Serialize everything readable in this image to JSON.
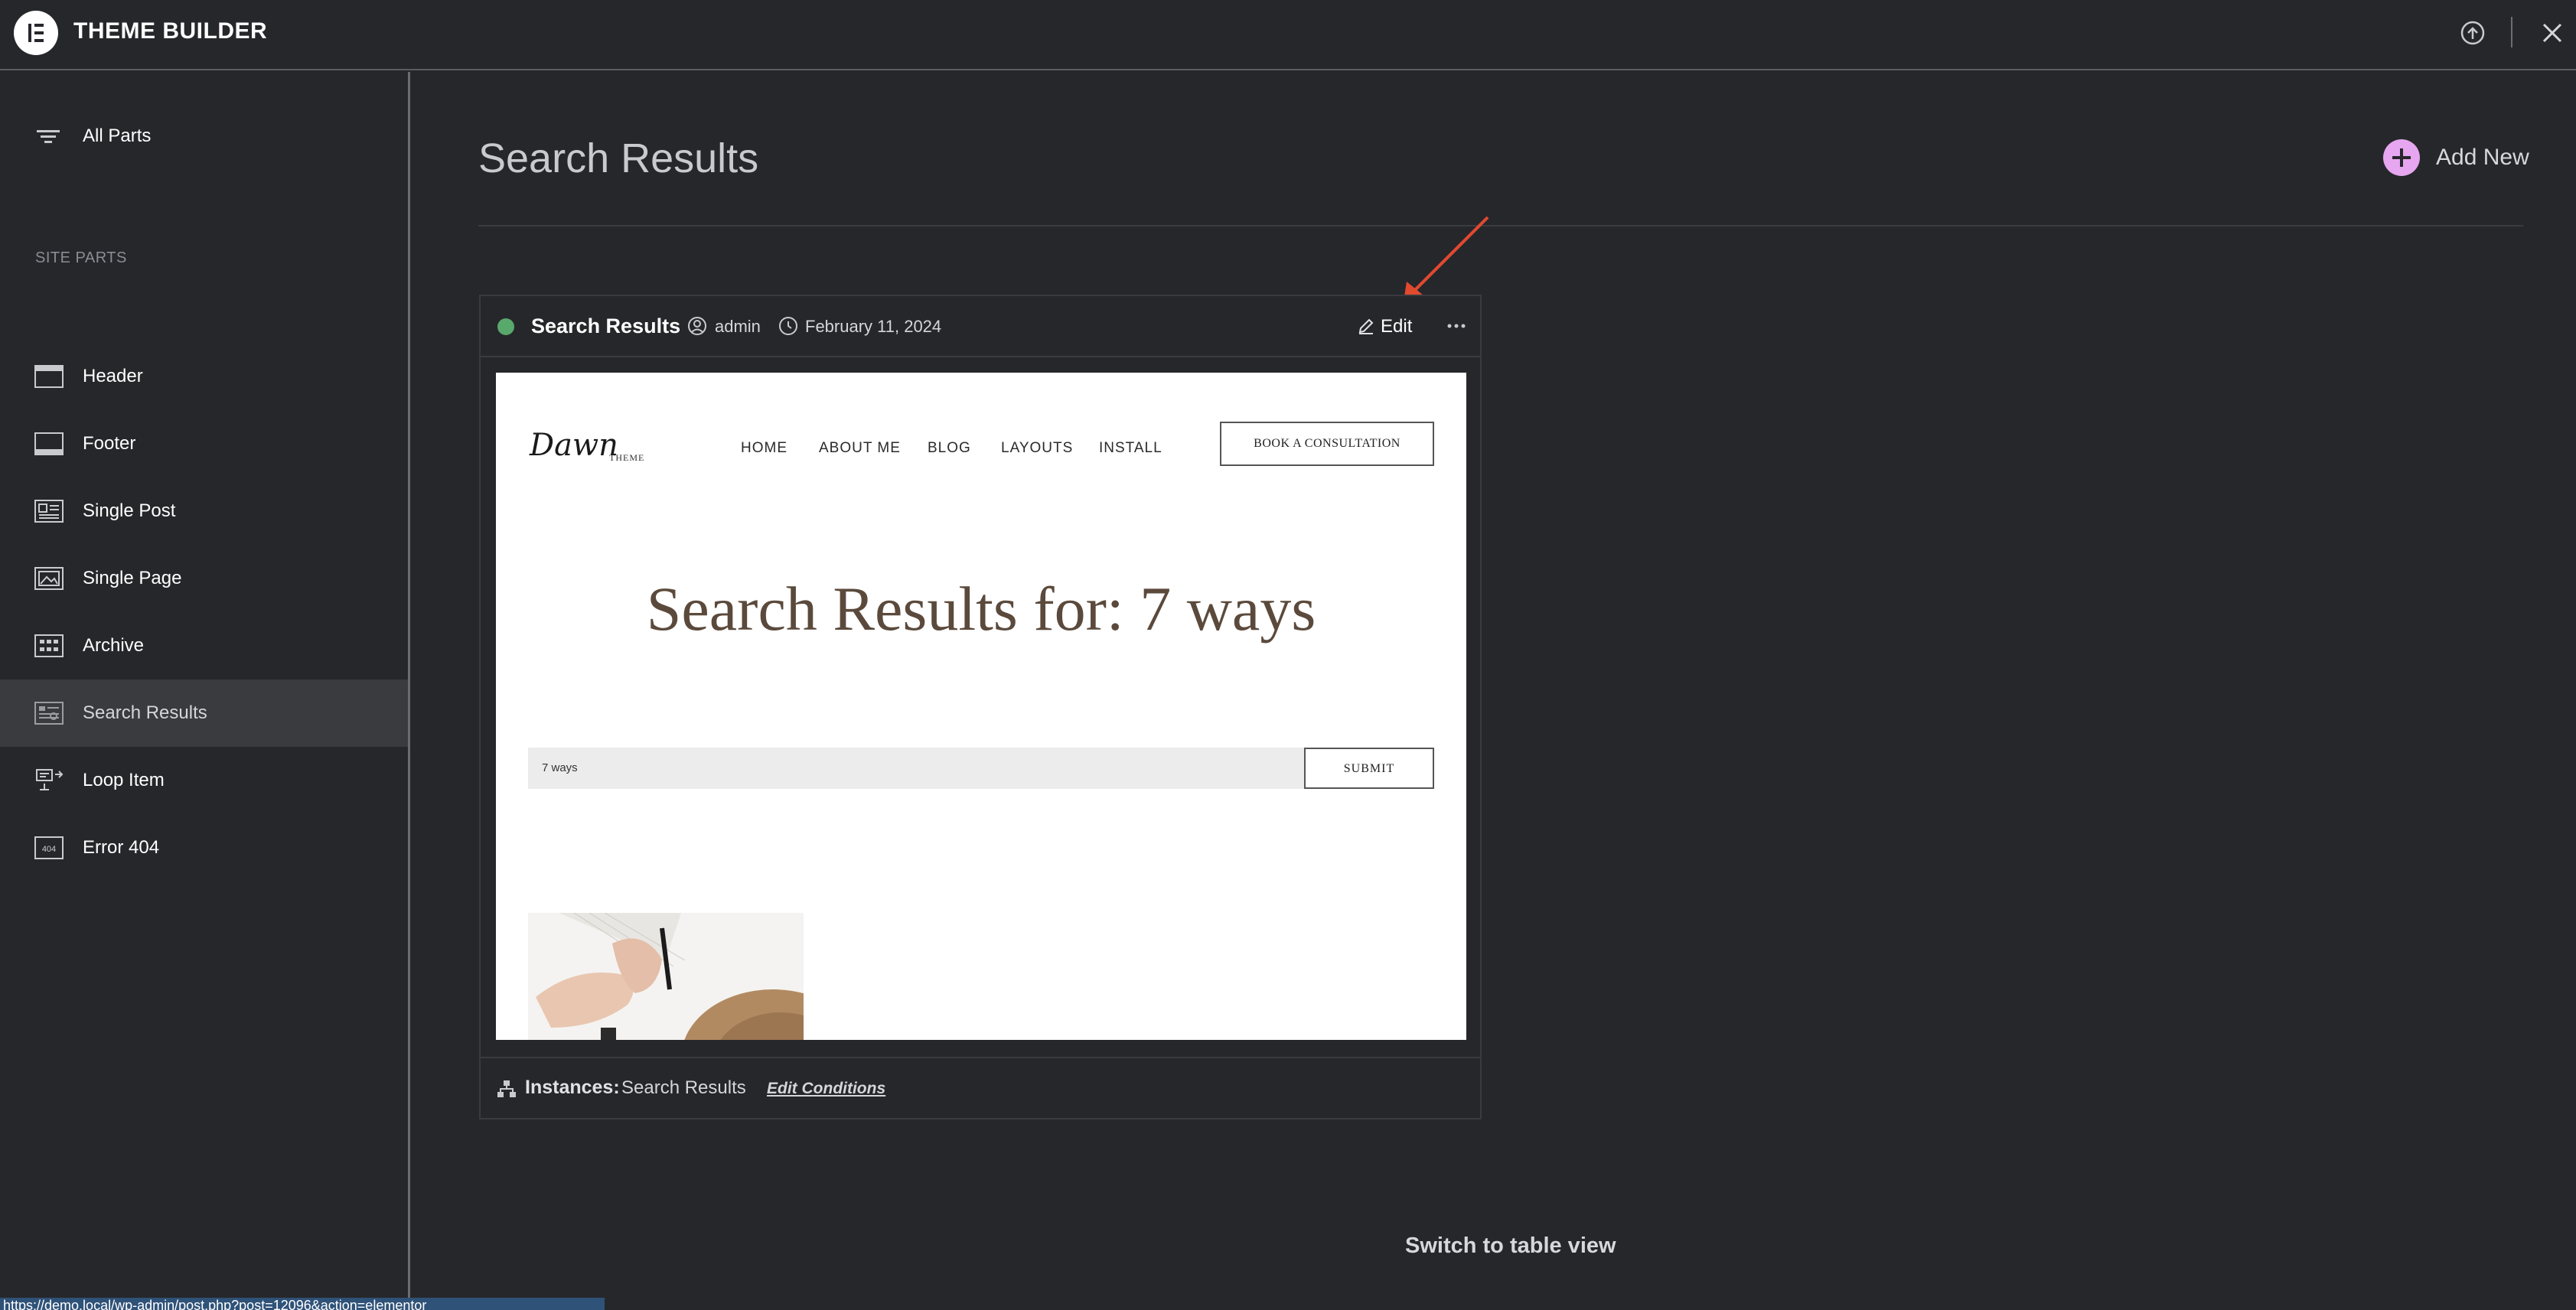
{
  "app": {
    "title": "THEME BUILDER"
  },
  "sidebar": {
    "all_parts": "All Parts",
    "section_label": "SITE PARTS",
    "items": [
      {
        "label": "Header",
        "icon": "header-layout-icon"
      },
      {
        "label": "Footer",
        "icon": "footer-layout-icon"
      },
      {
        "label": "Single Post",
        "icon": "single-post-icon"
      },
      {
        "label": "Single Page",
        "icon": "single-page-icon"
      },
      {
        "label": "Archive",
        "icon": "archive-grid-icon"
      },
      {
        "label": "Search Results",
        "icon": "search-results-icon",
        "active": true
      },
      {
        "label": "Loop Item",
        "icon": "loop-item-icon"
      },
      {
        "label": "Error 404",
        "icon": "error-404-icon"
      }
    ]
  },
  "main": {
    "title": "Search Results",
    "add_new": "Add New",
    "switch_view": "Switch to table view"
  },
  "card": {
    "title": "Search Results",
    "status_color": "#59a86c",
    "author": "admin",
    "date": "February 11, 2024",
    "edit": "Edit",
    "instances_label": "Instances:",
    "instances_value": "Search Results",
    "edit_conditions": "Edit Conditions",
    "preview": {
      "logo": "Dawn",
      "logo_sub": "THEME",
      "nav": [
        "HOME",
        "ABOUT ME",
        "BLOG",
        "LAYOUTS",
        "INSTALL"
      ],
      "cta": "BOOK A CONSULTATION",
      "heading": "Search Results for: 7 ways",
      "search_value": "7 ways",
      "submit": "SUBMIT"
    }
  },
  "status_bar": {
    "url": "https://demo.local/wp-admin/post.php?post=12096&action=elementor"
  },
  "colors": {
    "accent_add": "#e6a6f0",
    "annotation_arrow": "#e04a2f"
  }
}
